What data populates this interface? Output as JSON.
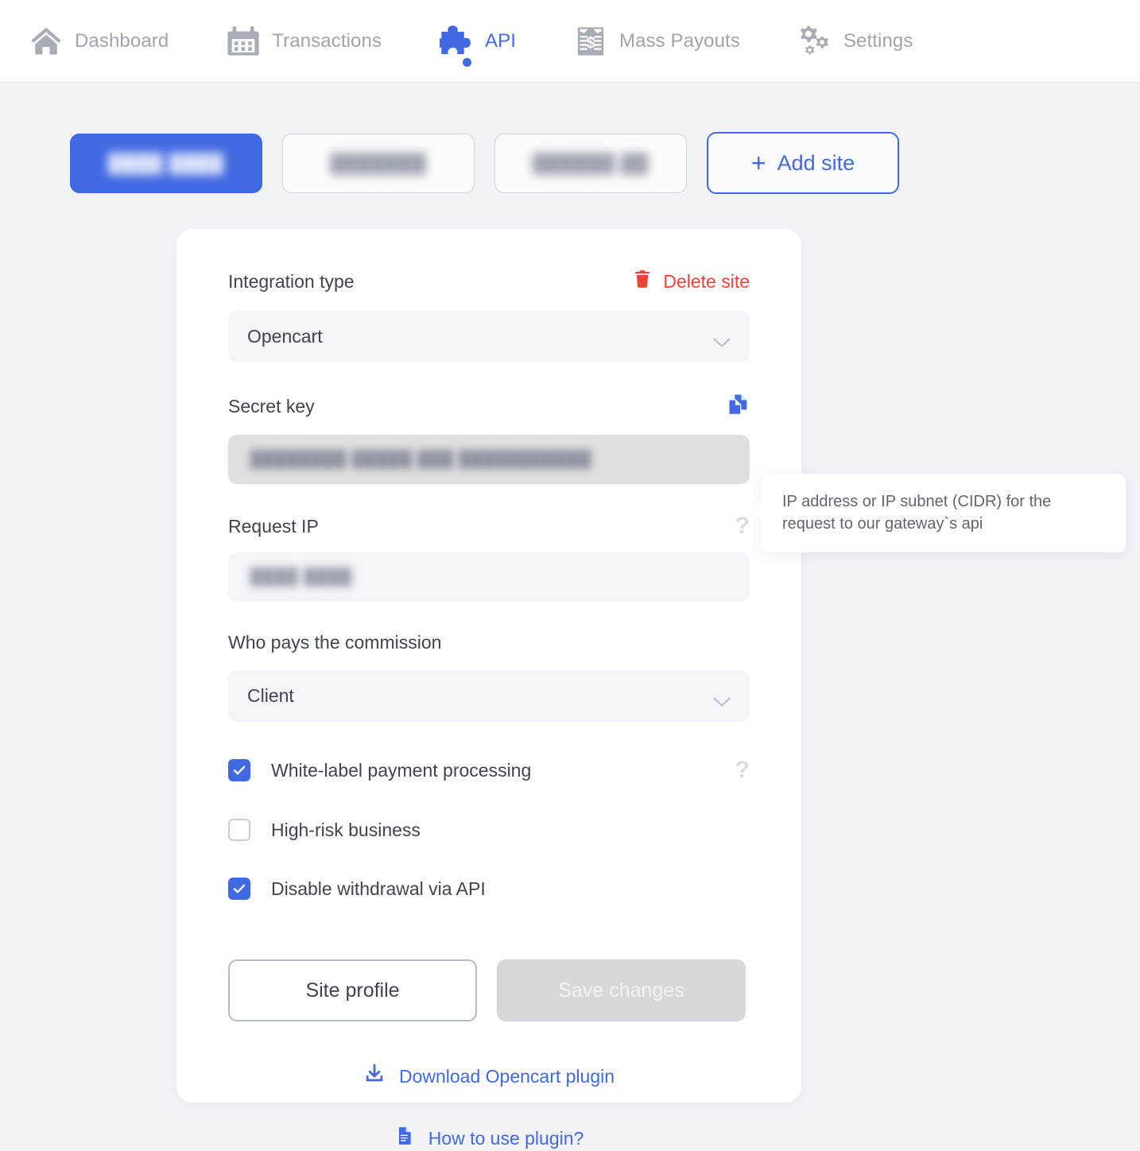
{
  "nav": {
    "items": [
      {
        "label": "Dashboard",
        "icon": "home-icon",
        "active": false
      },
      {
        "label": "Transactions",
        "icon": "calendar-icon",
        "active": false
      },
      {
        "label": "API",
        "icon": "puzzle-piece-icon",
        "active": true
      },
      {
        "label": "Mass Payouts",
        "icon": "cash-stack-icon",
        "active": false
      },
      {
        "label": "Settings",
        "icon": "gears-icon",
        "active": false
      }
    ]
  },
  "site_tabs": {
    "tabs": [
      {
        "label": "████ ████",
        "active": true
      },
      {
        "label": "███████",
        "active": false
      },
      {
        "label": "██████ ██",
        "active": false
      }
    ],
    "add_site_label": "Add site",
    "add_site_plus": "+"
  },
  "card": {
    "integration_type_label": "Integration type",
    "delete_site_label": "Delete site",
    "integration_type_value": "Opencart",
    "secret_key_label": "Secret key",
    "secret_key_value": "████████ █████ ███ ███████████",
    "request_ip_label": "Request IP",
    "request_ip_value": "████ ████",
    "request_ip_help": "?",
    "commission_label": "Who pays the commission",
    "commission_value": "Client",
    "checkboxes": [
      {
        "label": "White-label payment processing",
        "checked": true,
        "help": "?"
      },
      {
        "label": "High-risk business",
        "checked": false,
        "help": ""
      },
      {
        "label": "Disable withdrawal via API",
        "checked": true,
        "help": ""
      }
    ],
    "site_profile_label": "Site profile",
    "save_changes_label": "Save changes",
    "download_plugin_label": "Download Opencart plugin",
    "how_to_use_label": "How to use plugin?"
  },
  "tooltip": {
    "text": "IP address or IP subnet (CIDR) for the request to our gateway`s api"
  },
  "colors": {
    "accent": "#4169e1",
    "danger": "#ea4335",
    "page_bg": "#f2f3f7",
    "card_bg": "#ffffff",
    "muted_text": "#a0a4ad"
  }
}
